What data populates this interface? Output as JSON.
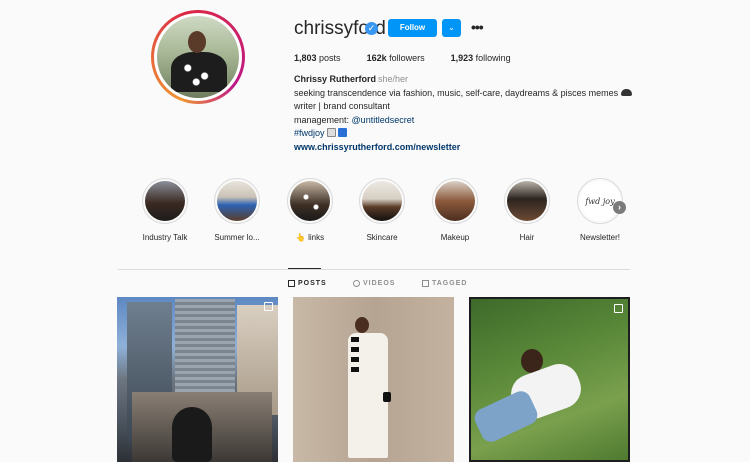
{
  "profile": {
    "username": "chrissyford",
    "follow_label": "Follow",
    "more_label": "•••",
    "stats": {
      "posts": "1,803",
      "posts_label": "posts",
      "followers": "162k",
      "followers_label": "followers",
      "following": "1,923",
      "following_label": "following"
    },
    "full_name": "Chrissy Rutherford",
    "pronouns": "she/her",
    "bio_line1": "seeking transcendence via fashion, music, self-care, daydreams & pisces memes",
    "bio_line2": "writer | brand consultant",
    "bio_line3_prefix": "management: ",
    "bio_line3_mention": "@untitledsecret",
    "bio_hashtag": "#fwdjoy",
    "website": "www.chrissyrutherford.com/newsletter"
  },
  "highlights": [
    {
      "label": "Industry Talk"
    },
    {
      "label": "Summer lo..."
    },
    {
      "label": "👆 links"
    },
    {
      "label": "Skincare"
    },
    {
      "label": "Makeup"
    },
    {
      "label": "Hair"
    },
    {
      "label": "Newsletter!",
      "cover_text": "fwd joy"
    }
  ],
  "tabs": [
    {
      "label": "POSTS",
      "active": true
    },
    {
      "label": "VIDEOS",
      "active": false
    },
    {
      "label": "TAGGED",
      "active": false
    }
  ],
  "colors": {
    "accent": "#0095f6",
    "verified": "#3897f0",
    "link": "#00376b"
  }
}
